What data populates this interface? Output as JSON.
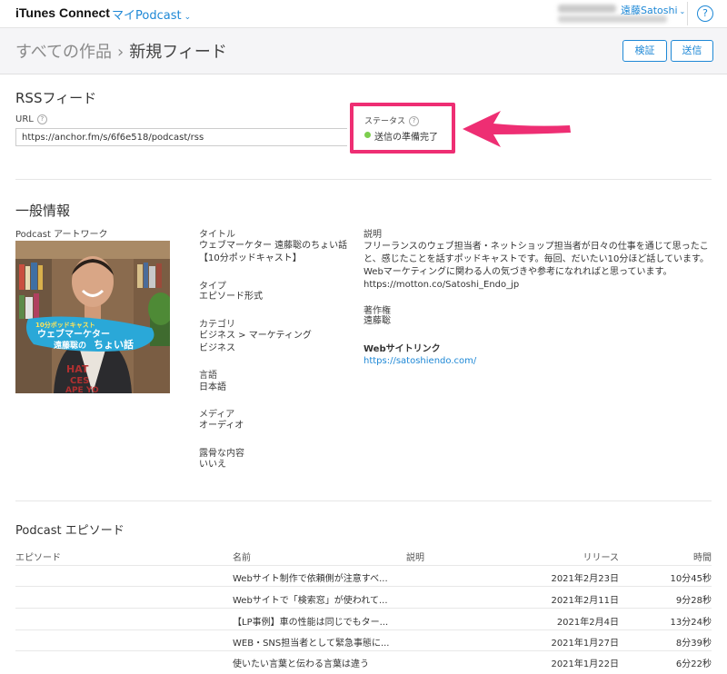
{
  "header": {
    "brand": "iTunes Connect",
    "podcast_menu": "マイPodcast",
    "user_menu": "遠藤Satoshi",
    "help": "?"
  },
  "titlebar": {
    "crumb_root": "すべての作品",
    "crumb_sep": "›",
    "crumb_current": "新規フィード",
    "verify_label": "検証",
    "send_label": "送信"
  },
  "rss": {
    "section_title": "RSSフィード",
    "url_label": "URL",
    "url_value": "https://anchor.fm/s/6f6e518/podcast/rss",
    "status_label": "ステータス",
    "status_value": "送信の準備完了",
    "status_color": "#7dce4f",
    "highlight_color": "#ee2e73"
  },
  "general": {
    "section_title": "一般情報",
    "artwork_label": "Podcast アートワーク",
    "artwork_text": {
      "line1": "10分ポッドキャスト",
      "line2": "ウェブマーケター",
      "line3": "遠藤聡の",
      "line3b": "ちょい話",
      "shirt1": "HAT",
      "shirt2": "CES",
      "shirt3": "APE YO"
    },
    "title_label": "タイトル",
    "title_value_1": "ウェブマーケター 遠藤聡のちょい話",
    "title_value_2": "【10分ポッドキャスト】",
    "type_label": "タイプ",
    "type_value": "エピソード形式",
    "category_label": "カテゴリ",
    "category_value_1": "ビジネス > マーケティング",
    "category_value_2": "ビジネス",
    "language_label": "言語",
    "language_value": "日本語",
    "media_label": "メディア",
    "media_value": "オーディオ",
    "explicit_label": "露骨な内容",
    "explicit_value": "いいえ",
    "description_label": "説明",
    "description_value": "フリーランスのウェブ担当者・ネットショップ担当者が日々の仕事を通じて思ったこと、感じたことを話すポッドキャストです。毎回、だいたい10分ほど話しています。Webマーケティングに関わる人の気づきや参考になれればと思っています。https://motton.co/Satoshi_Endo_jp",
    "copyright_label": "著作権",
    "copyright_value": "遠藤聡",
    "website_label": "Webサイトリンク",
    "website_value": "https://satoshiendo.com/"
  },
  "episodes": {
    "section_title": "Podcast エピソード",
    "columns": [
      "エピソード",
      "名前",
      "説明",
      "リリース",
      "時間"
    ],
    "rows": [
      {
        "name": "Webサイト制作で依頼側が注意すべ...",
        "release": "2021年2月23日",
        "duration": "10分45秒"
      },
      {
        "name": "Webサイトで「検索窓」が使われて...",
        "release": "2021年2月11日",
        "duration": "9分28秒"
      },
      {
        "name": "【LP事例】車の性能は同じでもター...",
        "release": "2021年2月4日",
        "duration": "13分24秒"
      },
      {
        "name": "WEB・SNS担当者として緊急事態に...",
        "release": "2021年1月27日",
        "duration": "8分39秒"
      },
      {
        "name": "使いたい言葉と伝わる言葉は違う",
        "release": "2021年1月22日",
        "duration": "6分22秒"
      }
    ]
  }
}
